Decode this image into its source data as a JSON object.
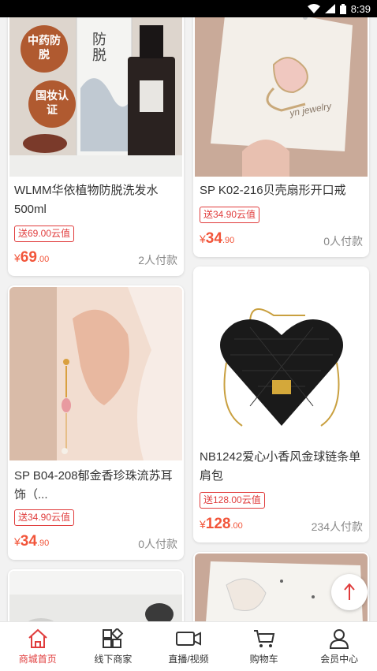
{
  "status_bar": {
    "time": "8:39"
  },
  "products": [
    {
      "title": "WLMM华依植物防脱洗发水500ml",
      "gift_badge": "送69.00云值",
      "price_currency": "¥",
      "price_int": "69",
      "price_dec": ".00",
      "paid_count": "2人付款",
      "image_texts": {
        "tag1": "中药防脱",
        "tag2": "国妆认证",
        "box_text": "防脱"
      }
    },
    {
      "title": "SP K02-216贝壳扇形开口戒",
      "gift_badge": "送34.90云值",
      "price_currency": "¥",
      "price_int": "34",
      "price_dec": ".90",
      "paid_count": "0人付款",
      "image_texts": {
        "card_brand": "yn jewelry"
      }
    },
    {
      "title": "SP B04-208郁金香珍珠流苏耳饰（...",
      "gift_badge": "送34.90云值",
      "price_currency": "¥",
      "price_int": "34",
      "price_dec": ".90",
      "paid_count": "0人付款"
    },
    {
      "title": "NB1242爱心小香风金球链条单肩包",
      "gift_badge": "送128.00云值",
      "price_currency": "¥",
      "price_int": "128",
      "price_dec": ".00",
      "paid_count": "234人付款"
    }
  ],
  "tabbar": {
    "items": [
      {
        "label": "商城首页",
        "icon": "home-icon",
        "active": true
      },
      {
        "label": "线下商家",
        "icon": "grid-icon",
        "active": false
      },
      {
        "label": "直播/视频",
        "icon": "video-camera-icon",
        "active": false
      },
      {
        "label": "购物车",
        "icon": "cart-icon",
        "active": false
      },
      {
        "label": "会员中心",
        "icon": "user-icon",
        "active": false
      }
    ]
  },
  "colors": {
    "accent": "#e03c3c",
    "price": "#f2553a"
  }
}
